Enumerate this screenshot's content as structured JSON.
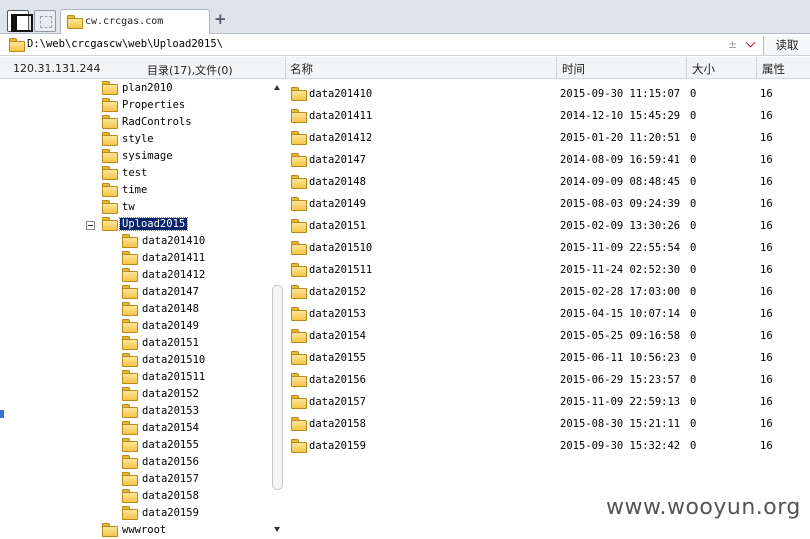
{
  "tab": {
    "title": "cw.crcgas.com",
    "add": "+"
  },
  "address": {
    "path": "D:\\web\\crcgascw\\web\\Upload2015\\",
    "plusminus": "±",
    "read_button": "读取"
  },
  "header": {
    "ip": "120.31.131.244",
    "counts": "目录(17),文件(0)",
    "col_name": "名称",
    "col_time": "时间",
    "col_size": "大小",
    "col_attr": "属性"
  },
  "tree": {
    "items": [
      {
        "label": "plan2010"
      },
      {
        "label": "Properties"
      },
      {
        "label": "RadControls"
      },
      {
        "label": "style"
      },
      {
        "label": "sysimage"
      },
      {
        "label": "test"
      },
      {
        "label": "time"
      },
      {
        "label": "tw"
      },
      {
        "label": "Upload2015",
        "selected": true
      },
      {
        "label": "data201410"
      },
      {
        "label": "data201411"
      },
      {
        "label": "data201412"
      },
      {
        "label": "data20147"
      },
      {
        "label": "data20148"
      },
      {
        "label": "data20149"
      },
      {
        "label": "data20151"
      },
      {
        "label": "data201510"
      },
      {
        "label": "data201511"
      },
      {
        "label": "data20152"
      },
      {
        "label": "data20153"
      },
      {
        "label": "data20154"
      },
      {
        "label": "data20155"
      },
      {
        "label": "data20156"
      },
      {
        "label": "data20157"
      },
      {
        "label": "data20158"
      },
      {
        "label": "data20159"
      },
      {
        "label": "wwwroot"
      }
    ]
  },
  "files": [
    {
      "name": "data201410",
      "time": "2015-09-30 11:15:07",
      "size": "0",
      "attr": "16"
    },
    {
      "name": "data201411",
      "time": "2014-12-10 15:45:29",
      "size": "0",
      "attr": "16"
    },
    {
      "name": "data201412",
      "time": "2015-01-20 11:20:51",
      "size": "0",
      "attr": "16"
    },
    {
      "name": "data20147",
      "time": "2014-08-09 16:59:41",
      "size": "0",
      "attr": "16"
    },
    {
      "name": "data20148",
      "time": "2014-09-09 08:48:45",
      "size": "0",
      "attr": "16"
    },
    {
      "name": "data20149",
      "time": "2015-08-03 09:24:39",
      "size": "0",
      "attr": "16"
    },
    {
      "name": "data20151",
      "time": "2015-02-09 13:30:26",
      "size": "0",
      "attr": "16"
    },
    {
      "name": "data201510",
      "time": "2015-11-09 22:55:54",
      "size": "0",
      "attr": "16"
    },
    {
      "name": "data201511",
      "time": "2015-11-24 02:52:30",
      "size": "0",
      "attr": "16"
    },
    {
      "name": "data20152",
      "time": "2015-02-28 17:03:00",
      "size": "0",
      "attr": "16"
    },
    {
      "name": "data20153",
      "time": "2015-04-15 10:07:14",
      "size": "0",
      "attr": "16"
    },
    {
      "name": "data20154",
      "time": "2015-05-25 09:16:58",
      "size": "0",
      "attr": "16"
    },
    {
      "name": "data20155",
      "time": "2015-06-11 10:56:23",
      "size": "0",
      "attr": "16"
    },
    {
      "name": "data20156",
      "time": "2015-06-29 15:23:57",
      "size": "0",
      "attr": "16"
    },
    {
      "name": "data20157",
      "time": "2015-11-09 22:59:13",
      "size": "0",
      "attr": "16"
    },
    {
      "name": "data20158",
      "time": "2015-08-30 15:21:11",
      "size": "0",
      "attr": "16"
    },
    {
      "name": "data20159",
      "time": "2015-09-30 15:32:42",
      "size": "0",
      "attr": "16"
    }
  ],
  "watermark": "www.wooyun.org",
  "colors": {
    "selection": "#0a246a",
    "folder": "#f3c54a",
    "dropdown": "#cc2222"
  },
  "icons": {
    "folder": "folder-icon",
    "sidebar_toggle": "sidebar-toggle-icon",
    "new_window": "new-window-icon"
  }
}
